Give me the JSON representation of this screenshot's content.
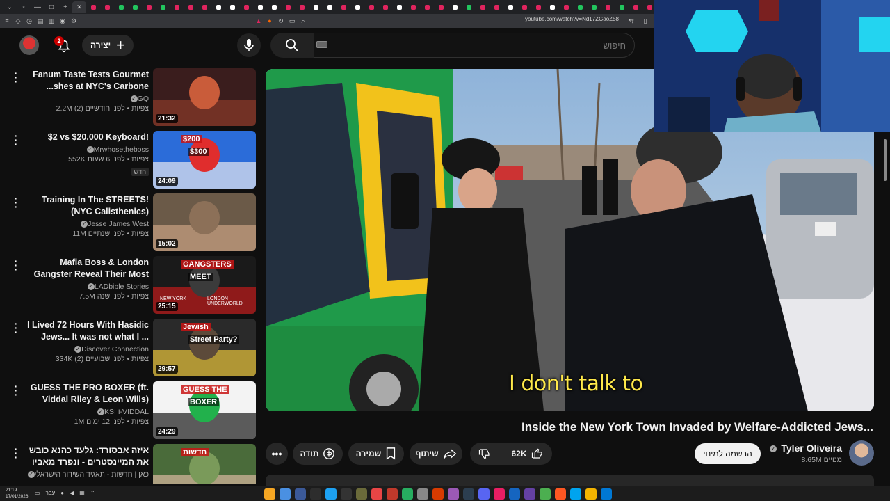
{
  "browser": {
    "url": "youtube.com/watch?v=Nd17ZGaoZ58",
    "tab_colors": [
      "#e0245e",
      "#e0245e",
      "#22c55e",
      "#22c55e",
      "#e0245e",
      "#22c55e",
      "#e0245e",
      "#e0245e",
      "#e0245e",
      "#ffffff",
      "#ffffff",
      "#e0245e",
      "#ffffff",
      "#ffffff",
      "#e0245e",
      "#e0245e",
      "#ffffff",
      "#ffffff",
      "#e0245e",
      "#ffffff",
      "#e0245e",
      "#e0245e",
      "#ffffff",
      "#e0245e",
      "#e0245e",
      "#e0245e",
      "#ffffff",
      "#22c55e",
      "#e0245e",
      "#e0245e",
      "#ffffff",
      "#e0245e",
      "#e0245e",
      "#ffffff",
      "#e0245e",
      "#22c55e",
      "#22c55e",
      "#e0245e",
      "#22c55e",
      "#e0245e",
      "#e0245e"
    ]
  },
  "header": {
    "notification_count": "2",
    "create_label": "יצירה",
    "search_placeholder": "חיפוש"
  },
  "related": [
    {
      "title": "Fanum Taste Tests Gourmet ...shes at NYC's Carbone Privato",
      "channel": "GQ",
      "meta": "2.2M צפיות • לפני חודשיים (2)",
      "duration": "21:32",
      "new_label": "",
      "thumb_colors": [
        "#3a1d1d",
        "#8a3b2a",
        "#c95c3a"
      ]
    },
    {
      "title": "$2 vs $20,000 Keyboard!",
      "channel": "Mrwhosetheboss",
      "meta": "552K צפיות • לפני 6 שעות",
      "duration": "24:09",
      "new_label": "חדש",
      "thumb_colors": [
        "#2b6cd9",
        "#e8e8f0",
        "#e02d2d"
      ],
      "thumb_text_a": "$200",
      "thumb_text_b": "$300"
    },
    {
      "title": "Training In The STREETS! (NYC Calisthenics)",
      "channel": "Jesse James West",
      "meta": "11M צפיות • לפני שנתיים",
      "duration": "15:02",
      "new_label": "",
      "thumb_colors": [
        "#6b5a48",
        "#c9a183",
        "#8c7058"
      ]
    },
    {
      "title": "Mafia Boss & London Gangster Reveal Their Most Violent ...",
      "channel": "LADbible Stories",
      "meta": "7.5M צפיות • לפני שנה",
      "duration": "25:15",
      "new_label": "",
      "thumb_colors": [
        "#1a1a1a",
        "#c21b1b",
        "#3b3b3b"
      ],
      "thumb_text_a": "GANGSTERS",
      "thumb_text_b": "MEET",
      "thumb_text_c": "NEW YORK",
      "thumb_text_d": "LONDON UNDERWORLD"
    },
    {
      "title": "I Lived 72 Hours With Hasidic Jews... It was not what I ...",
      "channel": "Discover Connection",
      "meta": "334K צפיות • לפני שבועיים (2)",
      "duration": "29:57",
      "new_label": "",
      "thumb_colors": [
        "#2a2a2a",
        "#e9c53a",
        "#5c4a3a"
      ],
      "thumb_text_a": "Jewish",
      "thumb_text_b": "Street Party?"
    },
    {
      "title": "GUESS THE PRO BOXER (ft. Viddal Riley & Leon Wills)",
      "channel": "KSI ו-VIDDAL",
      "meta": "1M צפיות • לפני 12 ימים",
      "duration": "24:29",
      "new_label": "",
      "thumb_colors": [
        "#f3f3f3",
        "#1a1a1a",
        "#22b14c"
      ],
      "thumb_text_a": "GUESS THE",
      "thumb_text_b": "BOXER"
    },
    {
      "title": "איזה אבסורד: גלעד כהנא כובש את המיינסטרים - ונפרד מאביו",
      "channel": "כאן | חדשות - תאגיד השידור הישראלי",
      "meta": "",
      "duration": "",
      "new_label": "",
      "thumb_colors": [
        "#4a6b3a",
        "#d8b8a0",
        "#7a9a5a"
      ],
      "thumb_text_a": "חדשות"
    }
  ],
  "player": {
    "subtitle": "I don't talk to"
  },
  "video": {
    "title": "Inside the New York Town Invaded by Welfare-Addicted Jews...",
    "channel_name": "Tyler Oliveira",
    "subscribers": "8.65M מנויים",
    "subscribe_label": "הרשמה למינוי",
    "likes": "62K",
    "share_label": "שיתוף",
    "save_label": "שמירה",
    "thanks_label": "תודה"
  },
  "taskbar": {
    "time": "21:19",
    "date": "17/01/2026",
    "lang": "עבר"
  }
}
